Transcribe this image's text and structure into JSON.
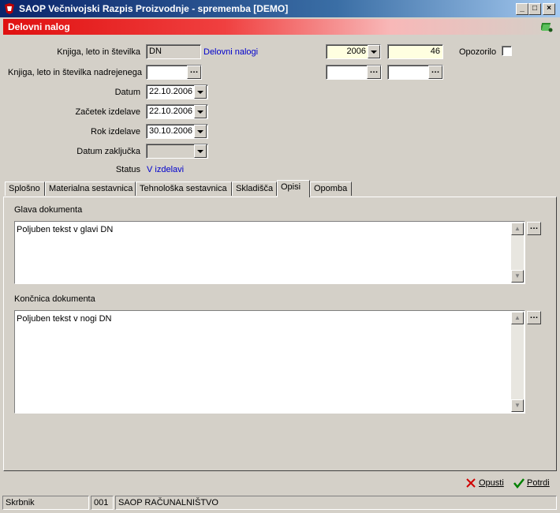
{
  "window": {
    "title": "SAOP  Večnivojski Razpis Proizvodnje  - sprememba [DEMO]",
    "min_glyph": "_",
    "max_glyph": "□",
    "close_glyph": "×"
  },
  "header": {
    "title": "Delovni nalog"
  },
  "form": {
    "book_label": "Knjiga, leto in številka",
    "book_value": "DN",
    "book_link": "Delovni nalogi",
    "year_value": "2006",
    "number_value": "46",
    "warning_label": "Opozorilo",
    "parent_label": "Knjiga, leto in številka nadrejenega",
    "parent_book_value": "",
    "parent_year_value": "",
    "parent_number_value": "",
    "date_label": "Datum",
    "date_value": "22.10.2006",
    "start_label": "Začetek izdelave",
    "start_value": "22.10.2006",
    "due_label": "Rok izdelave",
    "due_value": "30.10.2006",
    "close_label": "Datum zaključka",
    "close_value": "",
    "status_label": "Status",
    "status_value": "V izdelavi"
  },
  "tabs": [
    {
      "label": "Splošno"
    },
    {
      "label": "Materialna sestavnica"
    },
    {
      "label": "Tehnološka sestavnica"
    },
    {
      "label": "Skladišča"
    },
    {
      "label": "Opisi"
    },
    {
      "label": "Opomba"
    }
  ],
  "panel": {
    "head_label": "Glava dokumenta",
    "head_text": "Poljuben tekst v glavi DN",
    "foot_label": "Končnica dokumenta",
    "foot_text": "Poljuben tekst v nogi DN"
  },
  "actions": {
    "cancel": "Opusti",
    "confirm": "Potrdi"
  },
  "statusbar": {
    "user": "Skrbnik",
    "code": "001",
    "company": "SAOP RAČUNALNIŠTVO"
  },
  "colors": {
    "title_bar": "#0a246a",
    "header_red": "#e01010",
    "link": "#0000cc",
    "field_yellow": "#ffffe0"
  }
}
